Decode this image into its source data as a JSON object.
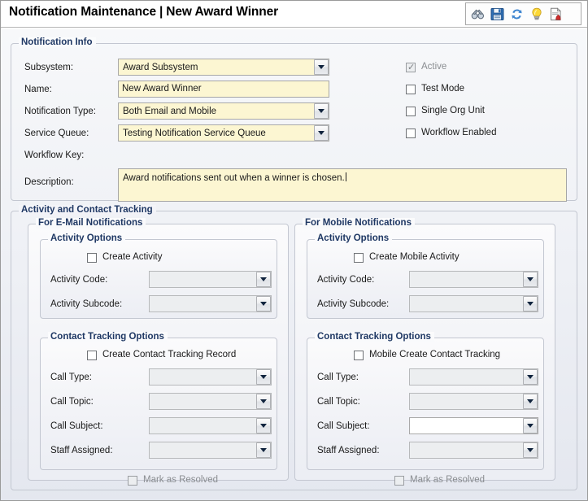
{
  "header": {
    "title_main": "Notification Maintenance",
    "separator": "|",
    "title_sub": "New Award Winner",
    "toolbar": {
      "items": [
        {
          "name": "binoculars-icon",
          "label": "Search"
        },
        {
          "name": "save-icon",
          "label": "Save"
        },
        {
          "name": "refresh-icon",
          "label": "Refresh"
        },
        {
          "name": "lightbulb-icon",
          "label": "Hints"
        },
        {
          "name": "report-icon",
          "label": "Report"
        }
      ]
    }
  },
  "notification_info": {
    "legend": "Notification Info",
    "fields": {
      "subsystem": {
        "label": "Subsystem:",
        "value": "Award Subsystem"
      },
      "name": {
        "label": "Name:",
        "value": "New Award Winner"
      },
      "notification_type": {
        "label": "Notification Type:",
        "value": "Both Email and Mobile"
      },
      "service_queue": {
        "label": "Service Queue:",
        "value": "Testing Notification Service Queue"
      },
      "workflow_key": {
        "label": "Workflow Key:",
        "value": ""
      },
      "description": {
        "label": "Description:",
        "value": "Award notifications sent out when a winner is chosen."
      }
    },
    "checkboxes": [
      {
        "label": "Active",
        "checked": true,
        "disabled": true
      },
      {
        "label": "Test Mode",
        "checked": false,
        "disabled": false
      },
      {
        "label": "Single Org Unit",
        "checked": false,
        "disabled": false
      },
      {
        "label": "Workflow Enabled",
        "checked": false,
        "disabled": false
      }
    ]
  },
  "activity_contact_tracking": {
    "legend": "Activity and Contact Tracking",
    "email": {
      "legend": "For E-Mail Notifications",
      "activity_options": {
        "legend": "Activity Options",
        "create_checkbox": {
          "label": "Create Activity",
          "checked": false,
          "disabled": false
        },
        "activity_code": {
          "label": "Activity Code:",
          "value": ""
        },
        "activity_subcode": {
          "label": "Activity Subcode:",
          "value": ""
        }
      },
      "contact_tracking_options": {
        "legend": "Contact Tracking Options",
        "create_checkbox": {
          "label": "Create Contact Tracking Record",
          "checked": false,
          "disabled": false
        },
        "call_type": {
          "label": "Call Type:",
          "value": ""
        },
        "call_topic": {
          "label": "Call Topic:",
          "value": ""
        },
        "call_subject": {
          "label": "Call Subject:",
          "value": ""
        },
        "staff_assigned": {
          "label": "Staff Assigned:",
          "value": ""
        },
        "mark_resolved": {
          "label": "Mark as Resolved",
          "checked": false,
          "disabled": true
        }
      }
    },
    "mobile": {
      "legend": "For Mobile Notifications",
      "activity_options": {
        "legend": "Activity Options",
        "create_checkbox": {
          "label": "Create Mobile Activity",
          "checked": false,
          "disabled": false
        },
        "activity_code": {
          "label": "Activity Code:",
          "value": ""
        },
        "activity_subcode": {
          "label": "Activity Subcode:",
          "value": ""
        }
      },
      "contact_tracking_options": {
        "legend": "Contact Tracking Options",
        "create_checkbox": {
          "label": "Mobile Create Contact Tracking",
          "checked": false,
          "disabled": false
        },
        "call_type": {
          "label": "Call Type:",
          "value": ""
        },
        "call_topic": {
          "label": "Call Topic:",
          "value": ""
        },
        "call_subject": {
          "label": "Call Subject:",
          "value": ""
        },
        "staff_assigned": {
          "label": "Staff Assigned:",
          "value": ""
        },
        "mark_resolved": {
          "label": "Mark as Resolved",
          "checked": false,
          "disabled": true
        }
      }
    }
  },
  "colors": {
    "legend_text": "#1f3864",
    "input_yellow": "#fcf6d2",
    "input_disabled": "#eceef0",
    "page_border": "#9a9a9a"
  }
}
